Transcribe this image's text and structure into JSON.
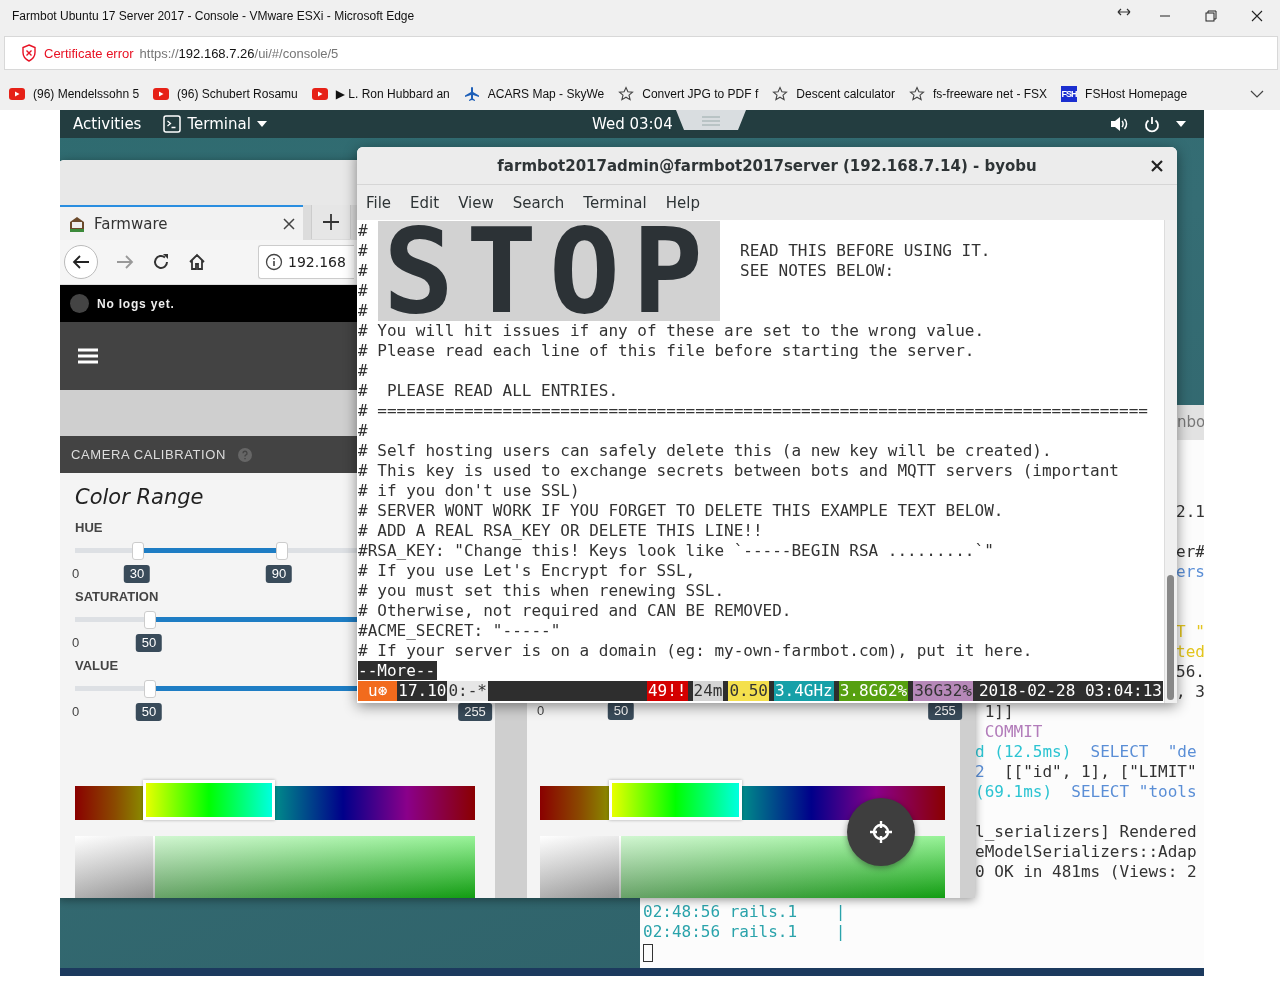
{
  "browser": {
    "title": "Farmbot Ubuntu 17 Server 2017 - Console - VMware ESXi - Microsoft Edge",
    "certificate_error": "Certificate error",
    "url": {
      "scheme": "https://",
      "host": "192.168.7.26",
      "path": "/ui/#/console/5"
    },
    "favorites": [
      {
        "kind": "youtube",
        "label": "(96) Mendelssohn  5"
      },
      {
        "kind": "youtube",
        "label": "(96) Schubert Rosamu"
      },
      {
        "kind": "youtube",
        "label": "▶ L. Ron Hubbard an"
      },
      {
        "kind": "plane",
        "label": "ACARS Map - SkyWe"
      },
      {
        "kind": "star",
        "label": "Convert JPG to PDF f"
      },
      {
        "kind": "star",
        "label": "Descent calculator"
      },
      {
        "kind": "star",
        "label": "fs-freeware net - FSX"
      },
      {
        "kind": "site",
        "icon_text": "FSH",
        "label": "FSHost Homepage"
      }
    ]
  },
  "desktop": {
    "activities": "Activities",
    "app_menu": "Terminal",
    "clock": "Wed 03:04"
  },
  "farmbot_window": {
    "tab": "Farmware",
    "url": "192.168",
    "log": "No logs yet.",
    "section": "CAMERA CALIBRATION",
    "columns": [
      {
        "title": "Color Range",
        "sliders": [
          {
            "label": "HUE",
            "min": "0",
            "handles": [
              {
                "level": 0.155,
                "label": "30"
              },
              {
                "level": 0.51,
                "label": "90"
              }
            ]
          },
          {
            "label": "SATURATION",
            "min": "0",
            "handles": [
              {
                "level": 0.185,
                "label": "50"
              }
            ]
          },
          {
            "label": "VALUE",
            "min": "0",
            "handles": [
              {
                "level": 0.185,
                "label": "50"
              }
            ],
            "max": "255"
          }
        ]
      },
      {
        "sliders": [
          {
            "min": "0",
            "value": "50",
            "max": "255"
          }
        ]
      }
    ]
  },
  "log_window": {
    "tab_fragment": "nbo",
    "upper_lines": [
      {
        "segments": [
          {
            "text": "2.1",
            "color": "#333333"
          }
        ]
      },
      {
        "kind": "blank"
      },
      {
        "segments": [
          {
            "text": "er#",
            "color": "#333333"
          }
        ]
      },
      {
        "segments": [
          {
            "text": "ers",
            "color": "#5a8ed6"
          }
        ]
      },
      {
        "kind": "blank"
      },
      {
        "kind": "blank"
      },
      {
        "segments": [
          {
            "text": "T \"",
            "color": "#e3c51c"
          }
        ]
      },
      {
        "segments": [
          {
            "text": "ted",
            "color": "#e3c51c"
          }
        ]
      },
      {
        "segments": [
          {
            "text": "56.",
            "color": "#333333"
          }
        ]
      },
      {
        "segments": [
          {
            "text": ", 3",
            "color": "#333333"
          }
        ]
      }
    ],
    "middle_lines": [
      {
        "segments": [
          {
            "text": " 1]]",
            "color": "#333333"
          }
        ]
      },
      {
        "segments": [
          {
            "text": " COMMIT",
            "color": "#b27cba"
          }
        ]
      },
      {
        "segments": [
          {
            "text": "d (12.5ms)",
            "color": "#2cc4d2"
          },
          {
            "text": "  SELECT  \"de",
            "color": "#5a8ed6"
          }
        ]
      },
      {
        "segments": [
          {
            "text": "2",
            "color": "#5a8ed6"
          },
          {
            "text": "  [[\"id\", 1], [\"LIMIT\"",
            "color": "#333333"
          }
        ]
      },
      {
        "segments": [
          {
            "text": "(69.1ms)",
            "color": "#2cc4d2"
          },
          {
            "text": "  SELECT \"tools",
            "color": "#5a8ed6"
          }
        ]
      },
      {
        "kind": "blank"
      },
      {
        "segments": [
          {
            "text": "l_serializers] Rendered",
            "color": "#333333"
          }
        ]
      },
      {
        "segments": [
          {
            "text": "eModelSerializers::Adap",
            "color": "#333333"
          }
        ]
      },
      {
        "segments": [
          {
            "text": "0 OK in 481ms (Views: 2",
            "color": "#333333"
          }
        ]
      }
    ],
    "lower_lines": [
      {
        "segments": [
          {
            "text": "02:48:56 rails.1    |",
            "color": "#2aa3ab"
          }
        ]
      },
      {
        "segments": [
          {
            "text": "02:48:56 rails.1    |",
            "color": "#2aa3ab"
          }
        ]
      },
      {
        "kind": "cursor"
      }
    ]
  },
  "terminal": {
    "title": "farmbot2017admin@farmbot2017server (192.168.7.14) - byobu",
    "menu": [
      "File",
      "Edit",
      "View",
      "Search",
      "Terminal",
      "Help"
    ],
    "banner": {
      "marks": [
        "#",
        "#",
        "#",
        "#",
        "#"
      ],
      "text": "STOP",
      "notes": [
        "READ THIS BEFORE USING IT.",
        "SEE NOTES BELOW:"
      ]
    },
    "lines": [
      "# You will hit issues if any of these are set to the wrong value.",
      "# Please read each line of this file before starting the server.",
      "#",
      "#  PLEASE READ ALL ENTRIES.",
      "# ================================================================================",
      "#",
      "# Self hosting users can safely delete this (a new key will be created).",
      "# This key is used to exchange secrets between bots and MQTT servers (important",
      "# if you don't use SSL)",
      "# SERVER WONT WORK IF YOU FORGET TO DELETE THIS EXAMPLE TEXT BELOW.",
      "# ADD A REAL RSA_KEY OR DELETE THIS LINE!!",
      "#RSA_KEY: \"Change this! Keys look like `-----BEGIN RSA .........`\"",
      "# If you use Let's Encrypt for SSL,",
      "# you must set this when renewing SSL.",
      "# Otherwise, not required and CAN BE REMOVED.",
      "#ACME_SECRET: \"-----\"",
      "# If your server is on a domain (eg: my-own-farmbot.com), put it here."
    ],
    "pager": "--More--",
    "status_left": [
      {
        "text": "u⊛",
        "color": "#f26b1d"
      },
      {
        "text": "17.10",
        "color": "#2e2e2e"
      },
      {
        "text": "0:-*",
        "color": "#e6e6e6"
      }
    ],
    "status_right": [
      {
        "text": "49!!",
        "color": "#d40000"
      },
      {
        "text": "24m",
        "color": "#d4d4d4"
      },
      {
        "text": "0.50",
        "color": "#f4e04d"
      },
      {
        "text": "3.4GHz",
        "color": "#16a0a8"
      },
      {
        "text": "3.8G62%",
        "color": "#56a010"
      },
      {
        "text": "36G32%",
        "color": "#b688b8"
      },
      {
        "text": "2018-02-28 03:04:13",
        "color": "#2e2e2e"
      }
    ]
  }
}
